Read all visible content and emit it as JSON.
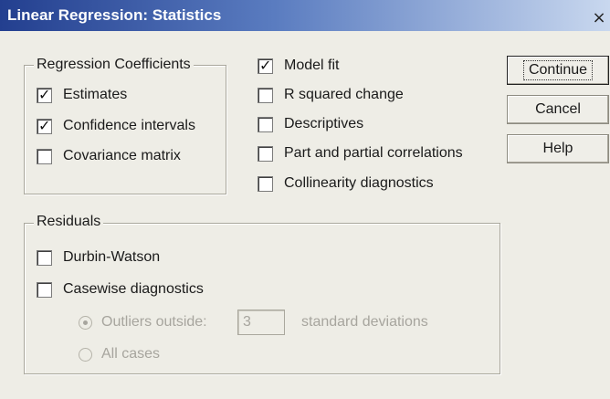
{
  "window": {
    "title": "Linear Regression: Statistics",
    "close_glyph": "×"
  },
  "regression_coefficients": {
    "legend": "Regression Coefficients",
    "items": [
      {
        "label": "Estimates",
        "checked": true
      },
      {
        "label": "Confidence intervals",
        "checked": true
      },
      {
        "label": "Covariance matrix",
        "checked": false
      }
    ]
  },
  "options": {
    "items": [
      {
        "label": "Model fit",
        "checked": true
      },
      {
        "label": "R squared change",
        "checked": false
      },
      {
        "label": "Descriptives",
        "checked": false
      },
      {
        "label": "Part and partial correlations",
        "checked": false
      },
      {
        "label": "Collinearity diagnostics",
        "checked": false
      }
    ]
  },
  "residuals": {
    "legend": "Residuals",
    "durbin_watson": {
      "label": "Durbin-Watson",
      "checked": false
    },
    "casewise": {
      "label": "Casewise diagnostics",
      "checked": false
    },
    "outliers_radio": {
      "label": "Outliers outside:",
      "selected": true
    },
    "outliers_value": "3",
    "std_dev_label": "standard deviations",
    "all_cases_radio": {
      "label": "All cases",
      "selected": false
    }
  },
  "buttons": {
    "continue": "Continue",
    "cancel": "Cancel",
    "help": "Help"
  },
  "check_glyph": "✓"
}
